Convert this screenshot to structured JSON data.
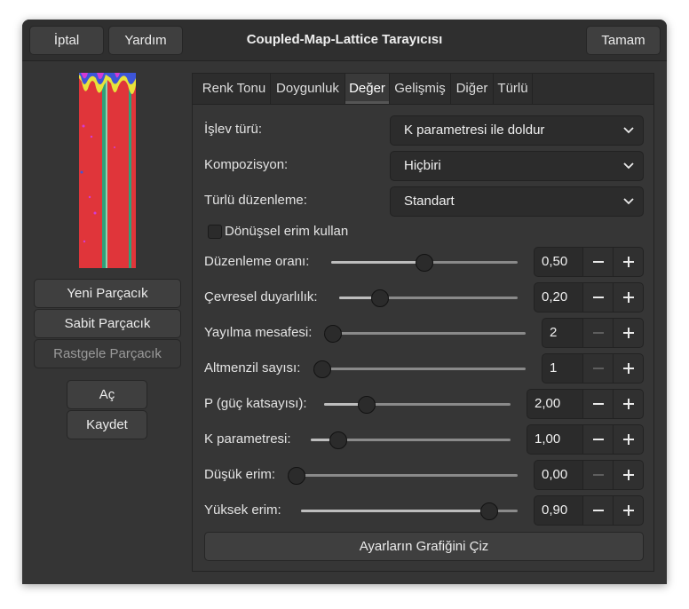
{
  "window": {
    "title": "Coupled-Map-Lattice Tarayıcısı",
    "cancel_label": "İptal",
    "help_label": "Yardım",
    "ok_label": "Tamam"
  },
  "left": {
    "new_seed": "Yeni Parçacık",
    "fixed_seed": "Sabit Parçacık",
    "random_seed": "Rastgele Parçacık",
    "open": "Aç",
    "save": "Kaydet"
  },
  "tabs": [
    "Renk Tonu",
    "Doygunluk",
    "Değer",
    "Gelişmiş",
    "Diğer",
    "Türlü"
  ],
  "active_tab": "Değer",
  "form": {
    "function_type_label": "İşlev türü:",
    "function_type_value": "K parametresi ile doldur",
    "composition_label": "Kompozisyon:",
    "composition_value": "Hiçbiri",
    "misc_arrange_label": "Türlü düzenleme:",
    "misc_arrange_value": "Standart",
    "cyclic_label": "Dönüşsel erim kullan",
    "cyclic_checked": false
  },
  "sliders": [
    {
      "label": "Düzenleme oranı:",
      "value": "0,50",
      "fraction": 0.5,
      "minus_enabled": true
    },
    {
      "label": "Çevresel duyarlılık:",
      "value": "0,20",
      "fraction": 0.2,
      "minus_enabled": true
    },
    {
      "label": "Yayılma mesafesi:",
      "value": "2",
      "fraction": 0.0,
      "minus_enabled": false
    },
    {
      "label": "Altmenzil sayısı:",
      "value": "1",
      "fraction": 0.0,
      "minus_enabled": false
    },
    {
      "label": "P (güç katsayısı):",
      "value": "2,00",
      "fraction": 0.2,
      "minus_enabled": true
    },
    {
      "label": "K parametresi:",
      "value": "1,00",
      "fraction": 0.1,
      "minus_enabled": true
    },
    {
      "label": "Düşük erim:",
      "value": "0,00",
      "fraction": 0.0,
      "minus_enabled": false
    },
    {
      "label": "Yüksek erim:",
      "value": "0,90",
      "fraction": 0.9,
      "minus_enabled": true
    }
  ],
  "plot_button": "Ayarların Grafiğini Çiz",
  "colors": {
    "preview_red": "#e0353a",
    "preview_stripe": "#2fa07a",
    "accent_yellow": "#e8e23a",
    "accent_blue": "#3d55d8",
    "accent_magenta": "#d23bd6"
  }
}
